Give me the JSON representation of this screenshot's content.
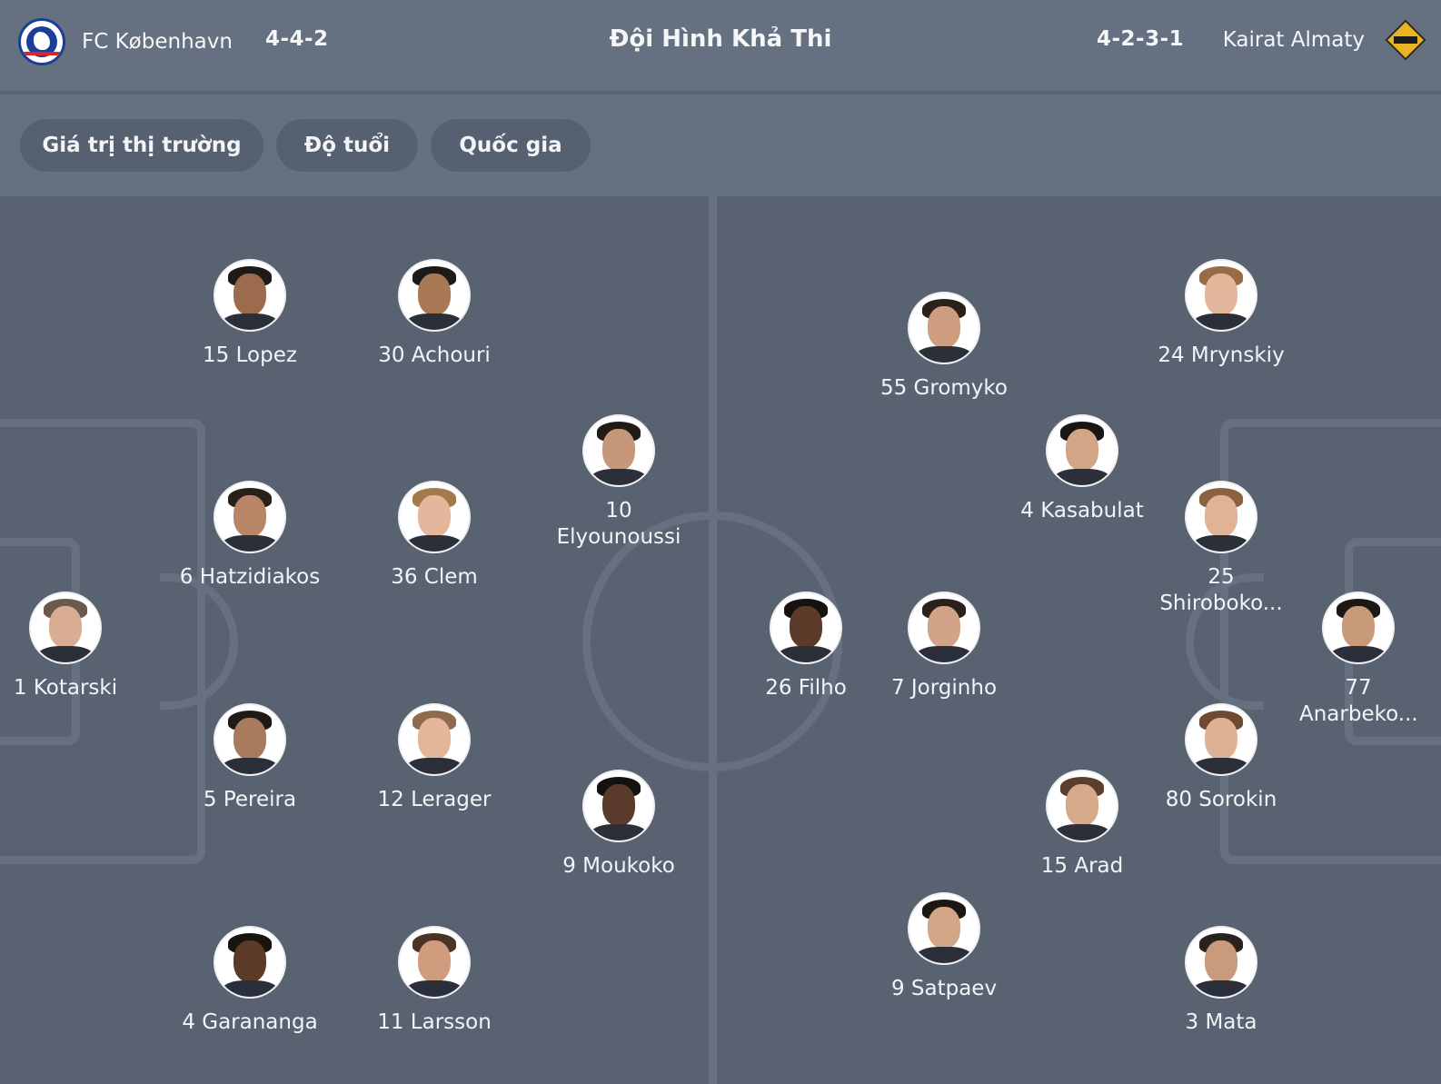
{
  "header": {
    "home_team": "FC København",
    "home_formation": "4-4-2",
    "title": "Đội Hình Khả Thi",
    "away_formation": "4-2-3-1",
    "away_team": "Kairat Almaty"
  },
  "filters": [
    "Giá trị thị trường",
    "Độ tuổi",
    "Quốc gia"
  ],
  "home_players": [
    {
      "label": "15 Lopez",
      "skin": "#9c6b4e",
      "hair": "#1e1a18"
    },
    {
      "label": "30 Achouri",
      "skin": "#a97854",
      "hair": "#1e1a18"
    },
    {
      "label": "10 Elyounoussi",
      "skin": "#c7977a",
      "hair": "#1f1b19"
    },
    {
      "label": "6 Hatzidiakos",
      "skin": "#b88566",
      "hair": "#2a2019"
    },
    {
      "label": "36 Clem",
      "skin": "#e2b79c",
      "hair": "#a57a4a"
    },
    {
      "label": "1 Kotarski",
      "skin": "#d8ad93",
      "hair": "#6a5a4c"
    },
    {
      "label": "5 Pereira",
      "skin": "#a87a5e",
      "hair": "#1e1a18"
    },
    {
      "label": "12 Lerager",
      "skin": "#e3b69a",
      "hair": "#8e6b4c"
    },
    {
      "label": "9 Moukoko",
      "skin": "#5a3a2a",
      "hair": "#141110"
    },
    {
      "label": "4 Garananga",
      "skin": "#5b3a28",
      "hair": "#1a1411"
    },
    {
      "label": "11 Larsson",
      "skin": "#cf9c7e",
      "hair": "#4a3426"
    }
  ],
  "away_players": [
    {
      "label": "55 Gromyko",
      "skin": "#cf9d80",
      "hair": "#2b211a"
    },
    {
      "label": "24 Mrynskiy",
      "skin": "#e4b79d",
      "hair": "#9a6a42"
    },
    {
      "label": "4 Kasabulat",
      "skin": "#d3a587",
      "hair": "#1a1614"
    },
    {
      "label": "25 Shiroboko...",
      "skin": "#e0b397",
      "hair": "#8a6240"
    },
    {
      "label": "26 Filho",
      "skin": "#5c3b2b",
      "hair": "#151210"
    },
    {
      "label": "7 Jorginho",
      "skin": "#d2a387",
      "hair": "#2a211b"
    },
    {
      "label": "77 Anarbeko...",
      "skin": "#c99a7a",
      "hair": "#1c1816"
    },
    {
      "label": "80 Sorokin",
      "skin": "#dfb296",
      "hair": "#6f4a32"
    },
    {
      "label": "15 Arad",
      "skin": "#d7a98b",
      "hair": "#5c3e2c"
    },
    {
      "label": "9 Satpaev",
      "skin": "#d4a688",
      "hair": "#1b1715"
    },
    {
      "label": "3 Mata",
      "skin": "#c99a7c",
      "hair": "#2a221c"
    }
  ]
}
